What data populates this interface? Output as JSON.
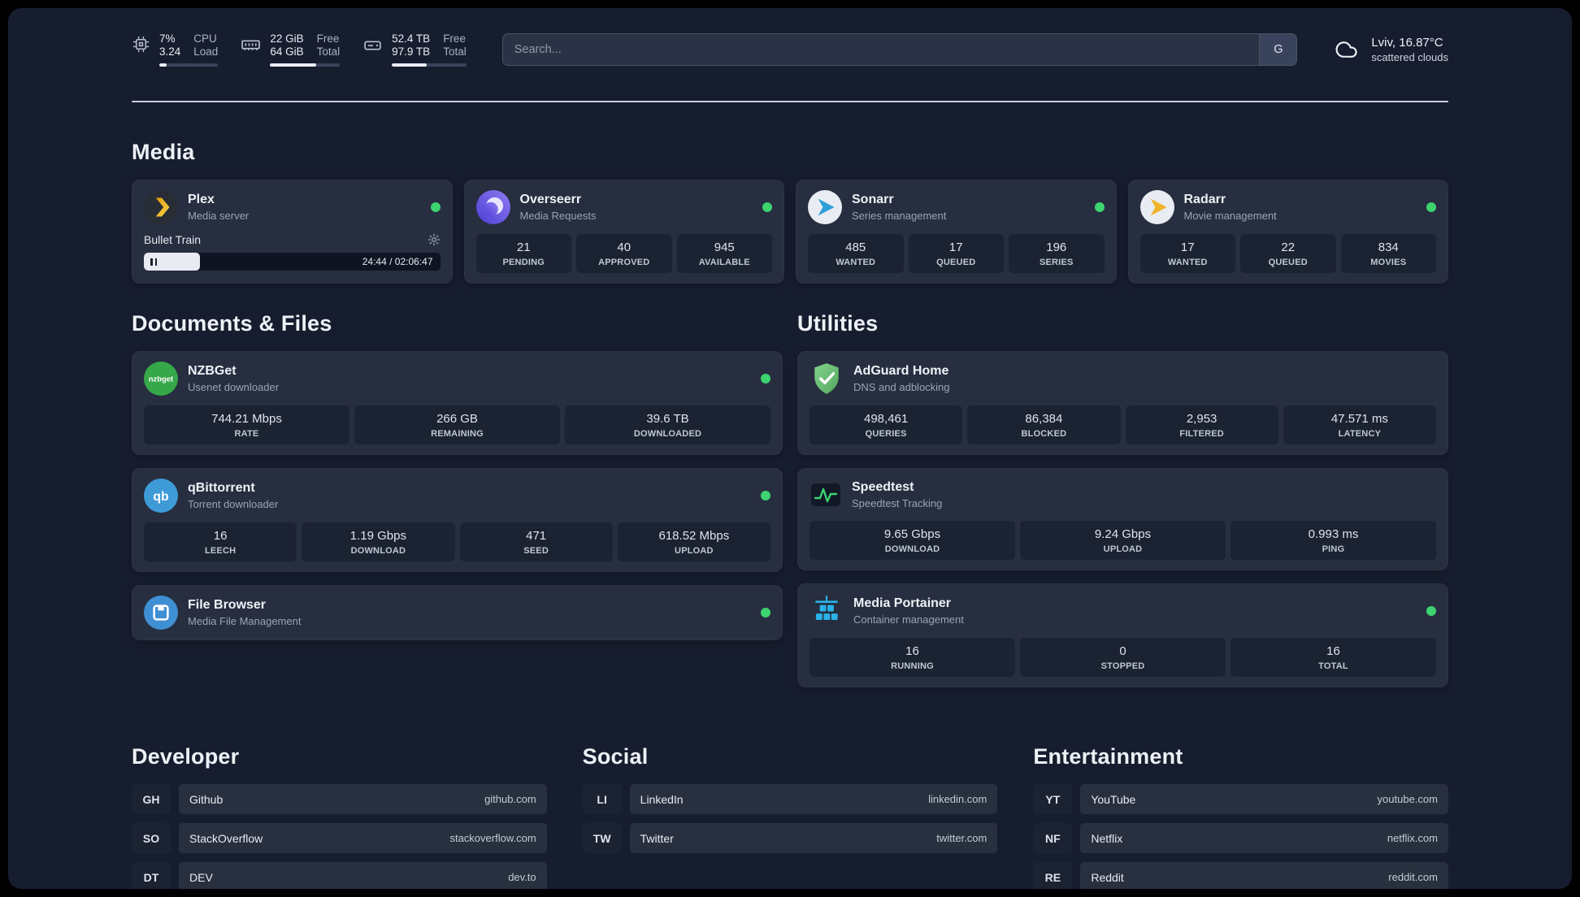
{
  "topbar": {
    "cpu": {
      "percent": "7%",
      "load": "3.24",
      "label_top": "CPU",
      "label_bottom": "Load",
      "bar": "12%"
    },
    "memory": {
      "free": "22 GiB",
      "total": "64 GiB",
      "label_top": "Free",
      "label_bottom": "Total",
      "bar": "66%"
    },
    "disk": {
      "free": "52.4 TB",
      "total": "97.9 TB",
      "label_top": "Free",
      "label_bottom": "Total",
      "bar": "47%"
    },
    "search": {
      "placeholder": "Search...",
      "engine_button": "G"
    },
    "weather": {
      "location_temp": "Lviv, 16.87°C",
      "condition": "scattered clouds"
    }
  },
  "media": {
    "title": "Media",
    "plex": {
      "name": "Plex",
      "subtitle": "Media server",
      "now_playing": "Bullet Train",
      "time": "24:44 / 02:06:47",
      "progress": "19%"
    },
    "cards": [
      {
        "name": "Overseerr",
        "subtitle": "Media Requests",
        "stats": [
          {
            "value": "21",
            "label": "PENDING"
          },
          {
            "value": "40",
            "label": "APPROVED"
          },
          {
            "value": "945",
            "label": "AVAILABLE"
          }
        ]
      },
      {
        "name": "Sonarr",
        "subtitle": "Series management",
        "stats": [
          {
            "value": "485",
            "label": "WANTED"
          },
          {
            "value": "17",
            "label": "QUEUED"
          },
          {
            "value": "196",
            "label": "SERIES"
          }
        ]
      },
      {
        "name": "Radarr",
        "subtitle": "Movie management",
        "stats": [
          {
            "value": "17",
            "label": "WANTED"
          },
          {
            "value": "22",
            "label": "QUEUED"
          },
          {
            "value": "834",
            "label": "MOVIES"
          }
        ]
      }
    ]
  },
  "documents": {
    "title": "Documents & Files",
    "cards": [
      {
        "name": "NZBGet",
        "subtitle": "Usenet downloader",
        "stats": [
          {
            "value": "744.21 Mbps",
            "label": "RATE"
          },
          {
            "value": "266 GB",
            "label": "REMAINING"
          },
          {
            "value": "39.6 TB",
            "label": "DOWNLOADED"
          }
        ]
      },
      {
        "name": "qBittorrent",
        "subtitle": "Torrent downloader",
        "stats": [
          {
            "value": "16",
            "label": "LEECH"
          },
          {
            "value": "1.19 Gbps",
            "label": "DOWNLOAD"
          },
          {
            "value": "471",
            "label": "SEED"
          },
          {
            "value": "618.52 Mbps",
            "label": "UPLOAD"
          }
        ]
      },
      {
        "name": "File Browser",
        "subtitle": "Media File Management",
        "stats": []
      }
    ]
  },
  "utilities": {
    "title": "Utilities",
    "cards": [
      {
        "name": "AdGuard Home",
        "subtitle": "DNS and adblocking",
        "stats": [
          {
            "value": "498,461",
            "label": "QUERIES"
          },
          {
            "value": "86,384",
            "label": "BLOCKED"
          },
          {
            "value": "2,953",
            "label": "FILTERED"
          },
          {
            "value": "47.571 ms",
            "label": "LATENCY"
          }
        ]
      },
      {
        "name": "Speedtest",
        "subtitle": "Speedtest Tracking",
        "stats": [
          {
            "value": "9.65 Gbps",
            "label": "DOWNLOAD"
          },
          {
            "value": "9.24 Gbps",
            "label": "UPLOAD"
          },
          {
            "value": "0.993 ms",
            "label": "PING"
          }
        ]
      },
      {
        "name": "Media Portainer",
        "subtitle": "Container management",
        "stats": [
          {
            "value": "16",
            "label": "RUNNING"
          },
          {
            "value": "0",
            "label": "STOPPED"
          },
          {
            "value": "16",
            "label": "TOTAL"
          }
        ]
      }
    ]
  },
  "bookmarks": {
    "developer": {
      "title": "Developer",
      "items": [
        {
          "tag": "GH",
          "name": "Github",
          "url": "github.com"
        },
        {
          "tag": "SO",
          "name": "StackOverflow",
          "url": "stackoverflow.com"
        },
        {
          "tag": "DT",
          "name": "DEV",
          "url": "dev.to"
        }
      ]
    },
    "social": {
      "title": "Social",
      "items": [
        {
          "tag": "LI",
          "name": "LinkedIn",
          "url": "linkedin.com"
        },
        {
          "tag": "TW",
          "name": "Twitter",
          "url": "twitter.com"
        }
      ]
    },
    "entertainment": {
      "title": "Entertainment",
      "items": [
        {
          "tag": "YT",
          "name": "YouTube",
          "url": "youtube.com"
        },
        {
          "tag": "NF",
          "name": "Netflix",
          "url": "netflix.com"
        },
        {
          "tag": "RE",
          "name": "Reddit",
          "url": "reddit.com"
        }
      ]
    }
  },
  "colors": {
    "accent_green": "#3dd36f",
    "background": "#161d2e",
    "card": "#262e3f"
  }
}
